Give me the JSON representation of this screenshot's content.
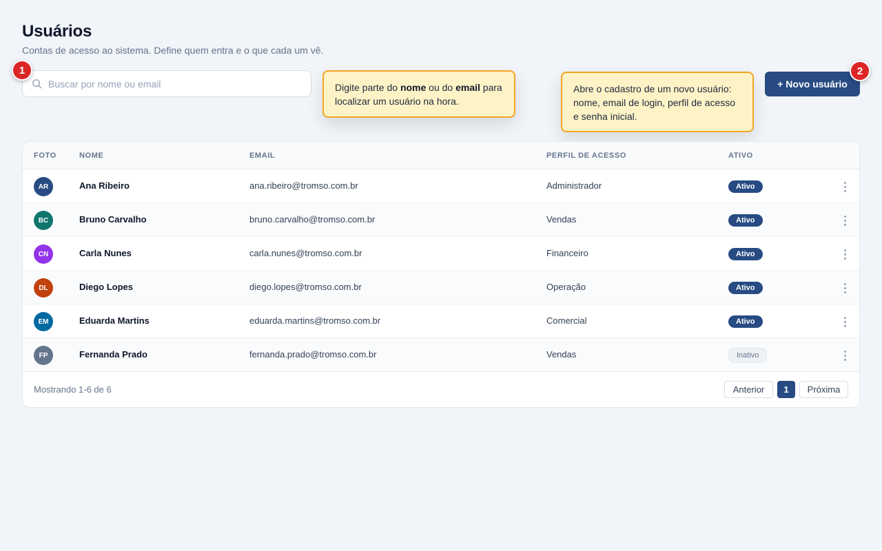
{
  "header": {
    "title": "Usuários",
    "subtitle": "Contas de acesso ao sistema. Define quem entra e o que cada um vê."
  },
  "search": {
    "placeholder": "Buscar por nome ou email",
    "value": "",
    "icon": "search-icon"
  },
  "steps": {
    "one": "1",
    "two": "2"
  },
  "tooltips": {
    "search": {
      "part1": "Digite parte do ",
      "bold1": "nome",
      "part2": " ou do ",
      "bold2": "email",
      "part3": " para localizar um usuário na hora."
    },
    "new_user": "Abre o cadastro de um novo usuário: nome, email de login, perfil de acesso e senha inicial."
  },
  "actions": {
    "new_user_label": "+ Novo usuário"
  },
  "table": {
    "columns": [
      "FOTO",
      "NOME",
      "EMAIL",
      "PERFIL DE ACESSO",
      "ATIVO"
    ],
    "rows": [
      {
        "initials": "AR",
        "avatar_color": "#274b82",
        "name": "Ana Ribeiro",
        "email": "ana.ribeiro@tromso.com.br",
        "role": "Administrador",
        "status": "Ativo",
        "active": true
      },
      {
        "initials": "BC",
        "avatar_color": "#0f766e",
        "name": "Bruno Carvalho",
        "email": "bruno.carvalho@tromso.com.br",
        "role": "Vendas",
        "status": "Ativo",
        "active": true
      },
      {
        "initials": "CN",
        "avatar_color": "#9333ea",
        "name": "Carla Nunes",
        "email": "carla.nunes@tromso.com.br",
        "role": "Financeiro",
        "status": "Ativo",
        "active": true
      },
      {
        "initials": "DL",
        "avatar_color": "#c2410c",
        "name": "Diego Lopes",
        "email": "diego.lopes@tromso.com.br",
        "role": "Operação",
        "status": "Ativo",
        "active": true
      },
      {
        "initials": "EM",
        "avatar_color": "#0369a1",
        "name": "Eduarda Martins",
        "email": "eduarda.martins@tromso.com.br",
        "role": "Comercial",
        "status": "Ativo",
        "active": true
      },
      {
        "initials": "FP",
        "avatar_color": "#64748b",
        "name": "Fernanda Prado",
        "email": "fernanda.prado@tromso.com.br",
        "role": "Vendas",
        "status": "Inativo",
        "active": false
      }
    ]
  },
  "footer": {
    "info": "Mostrando 1-6 de 6",
    "prev_label": "Anterior",
    "current_page": "1",
    "next_label": "Próxima"
  },
  "colors": {
    "primary": "#274b82",
    "badge": "#dc2626",
    "tooltip_bg": "#fef3c7",
    "tooltip_border": "#f5a524"
  }
}
